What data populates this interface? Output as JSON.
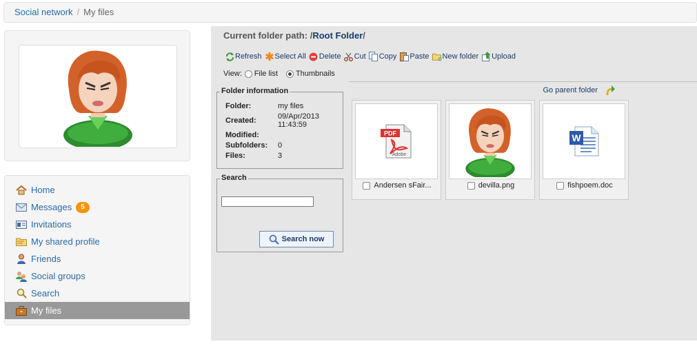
{
  "breadcrumb": {
    "root": "Social network",
    "separator": "/",
    "current": "My files"
  },
  "sidebar": {
    "items": [
      {
        "label": "Home",
        "icon": "home-icon"
      },
      {
        "label": "Messages",
        "icon": "envelope-icon",
        "badge": "5"
      },
      {
        "label": "Invitations",
        "icon": "invitation-icon"
      },
      {
        "label": "My shared profile",
        "icon": "folder-icon"
      },
      {
        "label": "Friends",
        "icon": "user-icon"
      },
      {
        "label": "Social groups",
        "icon": "group-icon"
      },
      {
        "label": "Search",
        "icon": "search-icon"
      },
      {
        "label": "My files",
        "icon": "briefcase-icon",
        "active": true
      }
    ]
  },
  "filemanager": {
    "path_label": "Current folder path:",
    "path_prefix": "/",
    "path_root": "Root Folder",
    "path_suffix": "/",
    "toolbar": {
      "refresh": "Refresh",
      "select_all": "Select All",
      "delete": "Delete",
      "cut": "Cut",
      "copy": "Copy",
      "paste": "Paste",
      "new_folder": "New folder",
      "upload": "Upload"
    },
    "view": {
      "label": "View:",
      "file_list": "File list",
      "thumbnails": "Thumbnails",
      "selected": "thumbnails"
    },
    "folder_info": {
      "title": "Folder information",
      "folder_label": "Folder:",
      "folder_value": "my files",
      "created_label": "Created:",
      "created_value_1": "09/Apr/2013",
      "created_value_2": "11:43:59",
      "modified_label": "Modified:",
      "modified_value": "",
      "subfolders_label": "Subfolders:",
      "subfolders_value": "0",
      "files_label": "Files:",
      "files_value": "3"
    },
    "search": {
      "title": "Search",
      "button": "Search now",
      "value": ""
    },
    "go_parent": "Go parent folder",
    "files": [
      {
        "name": "Andersen sFair...",
        "type": "pdf"
      },
      {
        "name": "devilla.png",
        "type": "image"
      },
      {
        "name": "fishpoem.doc",
        "type": "doc"
      }
    ]
  }
}
